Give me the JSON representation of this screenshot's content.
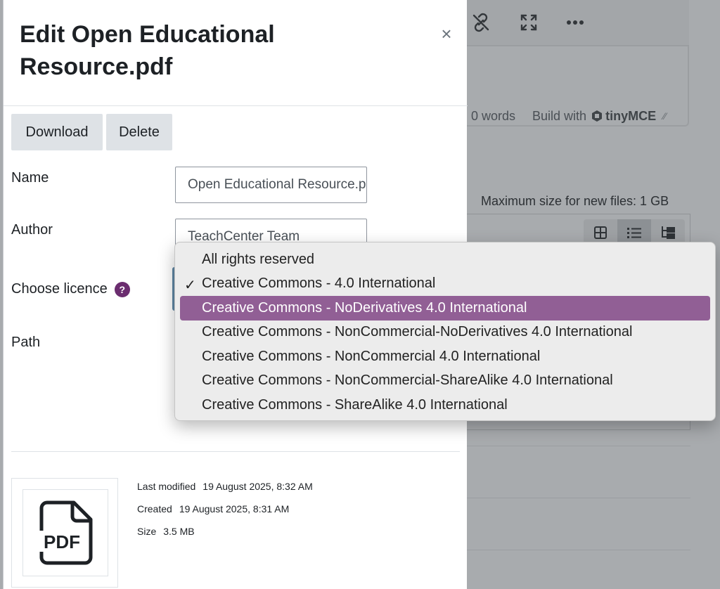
{
  "background": {
    "statusbar": {
      "words": "0 words",
      "build_with": "Build with",
      "brand": "tinyMCE"
    },
    "max_size": "Maximum size for new files: 1 GB"
  },
  "modal": {
    "title": "Edit Open Educational Resource.pdf",
    "close_symbol": "×",
    "buttons": {
      "download": "Download",
      "delete": "Delete"
    },
    "fields": {
      "name": {
        "label": "Name",
        "value": "Open Educational Resource.pdf"
      },
      "author": {
        "label": "Author",
        "value": "TeachCenter Team"
      },
      "licence": {
        "label": "Choose licence",
        "help": "?"
      },
      "path": {
        "label": "Path"
      }
    },
    "file_info": {
      "icon_text": "PDF",
      "last_modified": {
        "label": "Last modified",
        "value": "19 August 2025, 8:32 AM"
      },
      "created": {
        "label": "Created",
        "value": "19 August 2025, 8:31 AM"
      },
      "size": {
        "label": "Size",
        "value": "3.5 MB"
      }
    }
  },
  "licence_dropdown": {
    "checked_index": 1,
    "highlighted_index": 2,
    "check_symbol": "✓",
    "options": [
      "All rights reserved",
      "Creative Commons - 4.0 International",
      "Creative Commons - NoDerivatives 4.0 International",
      "Creative Commons - NonCommercial-NoDerivatives 4.0 International",
      "Creative Commons - NonCommercial 4.0 International",
      "Creative Commons - NonCommercial-ShareAlike 4.0 International",
      "Creative Commons - ShareAlike 4.0 International"
    ]
  },
  "colors": {
    "accent": "#6b2d6f",
    "highlight": "#915f95"
  }
}
